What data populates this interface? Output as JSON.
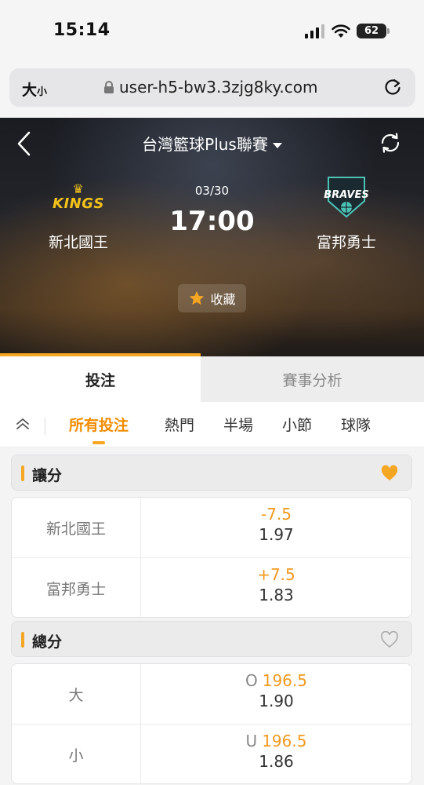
{
  "status": {
    "time": "15:14",
    "battery": "62"
  },
  "browser": {
    "text_size": "大",
    "text_size_small": "小",
    "url": "user-h5-bw3.3zjg8ky.com"
  },
  "match": {
    "league": "台灣籃球Plus聯賽",
    "date": "03/30",
    "kickoff": "17:00",
    "home": {
      "name": "新北國王",
      "logo_text": "KINGS"
    },
    "away": {
      "name": "富邦勇士",
      "logo_text": "BRAVES"
    },
    "favorite_label": "收藏"
  },
  "tabs": {
    "bet": "投注",
    "analysis": "賽事分析"
  },
  "subtabs": [
    "所有投注",
    "熱門",
    "半場",
    "小節",
    "球隊"
  ],
  "markets": {
    "handicap": {
      "title": "讓分",
      "favorited": true,
      "rows": [
        {
          "label": "新北國王",
          "prefix": "",
          "line": "-7.5",
          "price": "1.97"
        },
        {
          "label": "富邦勇士",
          "prefix": "",
          "line": "+7.5",
          "price": "1.83"
        }
      ]
    },
    "total": {
      "title": "總分",
      "favorited": false,
      "rows": [
        {
          "label": "大",
          "prefix": "O",
          "line": "196.5",
          "price": "1.90"
        },
        {
          "label": "小",
          "prefix": "U",
          "line": "196.5",
          "price": "1.86"
        }
      ]
    }
  },
  "colors": {
    "accent": "#f5a623",
    "accent_text": "#f28c00"
  }
}
